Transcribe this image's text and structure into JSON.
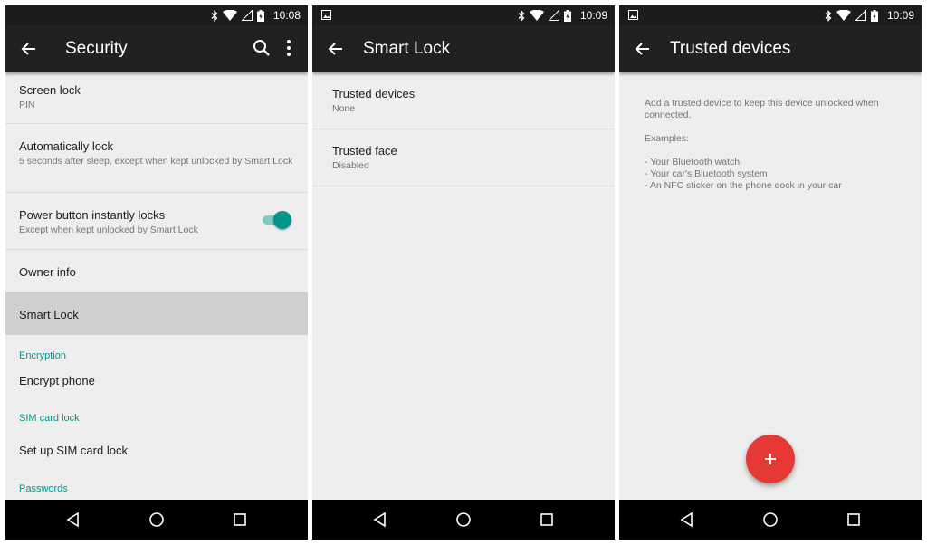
{
  "screens": [
    {
      "time": "10:08",
      "title": "Security",
      "items": [
        {
          "title": "Screen lock",
          "subtitle": "PIN"
        },
        {
          "title": "Automatically lock",
          "subtitle": "5 seconds after sleep, except when kept unlocked by Smart Lock"
        },
        {
          "title": "Power button instantly locks",
          "subtitle": "Except when kept unlocked by Smart Lock",
          "toggle_on": true
        },
        {
          "title": "Owner info"
        },
        {
          "title": "Smart Lock",
          "selected": true
        }
      ],
      "encryption_header": "Encryption",
      "encrypt_phone": "Encrypt phone",
      "sim_header": "SIM card lock",
      "sim_setup": "Set up SIM card lock",
      "passwords_header": "Passwords",
      "icons": [
        "bluetooth-icon",
        "wifi-icon",
        "signal-icon",
        "battery-icon",
        "search-icon",
        "more-vert-icon"
      ]
    },
    {
      "time": "10:09",
      "title": "Smart Lock",
      "items": [
        {
          "title": "Trusted devices",
          "subtitle": "None"
        },
        {
          "title": "Trusted face",
          "subtitle": "Disabled"
        }
      ]
    },
    {
      "time": "10:09",
      "title": "Trusted devices",
      "description": "Add a trusted device to keep this device unlocked when connected.",
      "examples_label": "Examples:",
      "examples": [
        "- Your Bluetooth watch",
        "- Your car's Bluetooth system",
        "- An NFC sticker on the phone dock in your car"
      ]
    }
  ],
  "colors": {
    "accent": "#009688",
    "fab": "#e53935",
    "appbar": "#212121",
    "selected_row": "#cfcfcf"
  }
}
